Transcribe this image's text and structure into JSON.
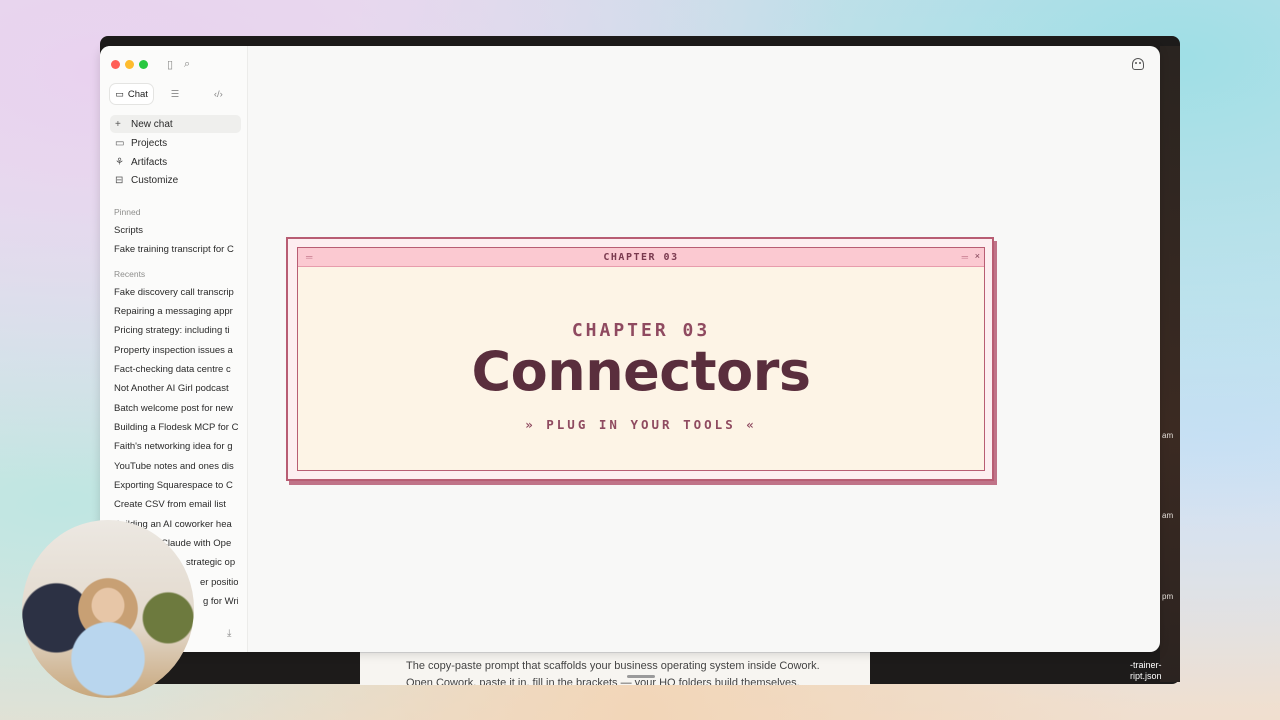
{
  "sidebar": {
    "tabs": [
      {
        "label": "Chat",
        "icon": "chat-icon"
      },
      {
        "label": "",
        "icon": "tasks-icon"
      },
      {
        "label": "",
        "icon": "code-icon"
      }
    ],
    "nav": [
      {
        "label": "New chat",
        "icon": "plus-icon"
      },
      {
        "label": "Projects",
        "icon": "folder-icon"
      },
      {
        "label": "Artifacts",
        "icon": "artifacts-icon"
      },
      {
        "label": "Customize",
        "icon": "briefcase-icon"
      }
    ],
    "pinned_label": "Pinned",
    "pinned": [
      "Scripts",
      "Fake training transcript for C"
    ],
    "recents_label": "Recents",
    "recents": [
      "Fake discovery call transcrip",
      "Repairing a messaging appr",
      "Pricing strategy: including ti",
      "Property inspection issues a",
      "Fact-checking data centre c",
      "Not Another AI Girl podcast",
      "Batch welcome post for new",
      "Building a Flodesk MCP for C",
      "Faith's networking idea for g",
      "YouTube notes and ones dis",
      "Exporting Squarespace to C",
      "Create CSV from email list",
      "Building an AI coworker hea",
      "Claude with Ope",
      "strategic op",
      "er position",
      "g for Wrig"
    ]
  },
  "card": {
    "bar_title": "CHAPTER 03",
    "chapter_label": "CHAPTER 03",
    "title": "Connectors",
    "subtitle": "» PLUG IN YOUR TOOLS «"
  },
  "background": {
    "doc_line1": "The copy-paste prompt that scaffolds your business operating system inside Cowork.",
    "doc_line2": "Open Cowork, paste it in, fill in the brackets — your HQ folders build themselves.",
    "times": [
      "am",
      "am",
      "pm"
    ],
    "file_name_1": "-trainer-",
    "file_name_2": "ript.json"
  },
  "colors": {
    "card_border": "#b85d73",
    "card_bg": "#fdf4e6",
    "title_color": "#5a2e3d",
    "bar_pink": "#fbc9d1"
  }
}
